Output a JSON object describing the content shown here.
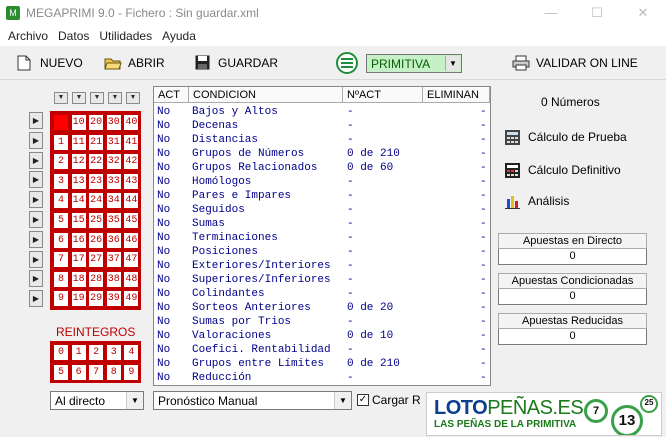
{
  "window": {
    "app_icon": "M",
    "title": "MEGAPRIMI 9.0 - Fichero : Sin guardar.xml",
    "controls": [
      "—",
      "☐",
      "✕"
    ]
  },
  "menu": [
    "Archivo",
    "Datos",
    "Utilidades",
    "Ayuda"
  ],
  "toolbar": {
    "nuevo": "NUEVO",
    "abrir": "ABRIR",
    "guardar": "GUARDAR",
    "game_select": "PRIMITIVA",
    "validar": "VALIDAR ON LINE"
  },
  "numbers": {
    "rows": [
      [
        "",
        "10",
        "20",
        "30",
        "40"
      ],
      [
        "1",
        "11",
        "21",
        "31",
        "41"
      ],
      [
        "2",
        "12",
        "22",
        "32",
        "42"
      ],
      [
        "3",
        "13",
        "23",
        "33",
        "43"
      ],
      [
        "4",
        "14",
        "24",
        "34",
        "44"
      ],
      [
        "5",
        "15",
        "25",
        "35",
        "45"
      ],
      [
        "6",
        "16",
        "26",
        "36",
        "46"
      ],
      [
        "7",
        "17",
        "27",
        "37",
        "47"
      ],
      [
        "8",
        "18",
        "28",
        "38",
        "48"
      ],
      [
        "9",
        "19",
        "29",
        "39",
        "49"
      ]
    ],
    "selected": [
      [
        0,
        0
      ]
    ]
  },
  "reintegros": {
    "title": "REINTEGROS",
    "rows": [
      [
        "0",
        "1",
        "2",
        "3",
        "4"
      ],
      [
        "5",
        "6",
        "7",
        "8",
        "9"
      ]
    ]
  },
  "conditions_table": {
    "headers": [
      "ACT",
      "CONDICION",
      "NºACT",
      "ELIMINAN"
    ],
    "rows": [
      {
        "act": "No",
        "condicion": "Bajos y Altos",
        "nact": "-",
        "eliminan": "-"
      },
      {
        "act": "No",
        "condicion": "Decenas",
        "nact": "-",
        "eliminan": "-"
      },
      {
        "act": "No",
        "condicion": "Distancias",
        "nact": "-",
        "eliminan": "-"
      },
      {
        "act": "No",
        "condicion": "Grupos de Números",
        "nact": "0 de 210",
        "eliminan": "-"
      },
      {
        "act": "No",
        "condicion": "Grupos Relacionados",
        "nact": "0 de 60",
        "eliminan": "-"
      },
      {
        "act": "No",
        "condicion": "Homólogos",
        "nact": "-",
        "eliminan": "-"
      },
      {
        "act": "No",
        "condicion": "Pares e Impares",
        "nact": "-",
        "eliminan": "-"
      },
      {
        "act": "No",
        "condicion": "Seguidos",
        "nact": "-",
        "eliminan": "-"
      },
      {
        "act": "No",
        "condicion": "Sumas",
        "nact": "-",
        "eliminan": "-"
      },
      {
        "act": "No",
        "condicion": "Terminaciones",
        "nact": "-",
        "eliminan": "-"
      },
      {
        "act": "No",
        "condicion": "Posiciones",
        "nact": "-",
        "eliminan": "-"
      },
      {
        "act": "No",
        "condicion": "Exteriores/Interiores",
        "nact": "-",
        "eliminan": "-"
      },
      {
        "act": "No",
        "condicion": "Superiores/Inferiores",
        "nact": "-",
        "eliminan": "-"
      },
      {
        "act": "No",
        "condicion": "Colindantes",
        "nact": "-",
        "eliminan": "-"
      },
      {
        "act": "No",
        "condicion": "Sorteos Anteriores",
        "nact": "0 de 20",
        "eliminan": "-"
      },
      {
        "act": "No",
        "condicion": "Sumas por Trios",
        "nact": "-",
        "eliminan": "-"
      },
      {
        "act": "No",
        "condicion": "Valoraciones",
        "nact": "0 de 10",
        "eliminan": "-"
      },
      {
        "act": "No",
        "condicion": "Coefici. Rentabilidad",
        "nact": "-",
        "eliminan": "-"
      },
      {
        "act": "No",
        "condicion": "Grupos entre Límites",
        "nact": "0 de 210",
        "eliminan": "-"
      },
      {
        "act": "No",
        "condicion": "Reducción",
        "nact": "-",
        "eliminan": "-"
      }
    ]
  },
  "right_panel": {
    "count_label": "0 Números",
    "calculo_prueba": "Cálculo de Prueba",
    "calculo_definitivo": "Cálculo Definitivo",
    "analisis": "Análisis",
    "stats": [
      {
        "label": "Apuestas en Directo",
        "value": "0"
      },
      {
        "label": "Apuestas Condicionadas",
        "value": "0"
      },
      {
        "label": "Apuestas Reducidas",
        "value": "0"
      }
    ]
  },
  "bottom": {
    "mode_select": "Al directo",
    "forecast_select": "Pronóstico Manual",
    "cargar_label": "Cargar R",
    "cargar_checked": "✓"
  },
  "banner": {
    "brand_a": "LOTO",
    "brand_b": "PEÑAS.ES",
    "slogan": "LAS PEÑAS DE LA PRIMITIVA",
    "balls": [
      "7",
      "13",
      "25"
    ]
  },
  "colors": {
    "grid_red": "#c00000",
    "table_text": "#00008b",
    "primitiva_green": "#c8f0c8"
  }
}
